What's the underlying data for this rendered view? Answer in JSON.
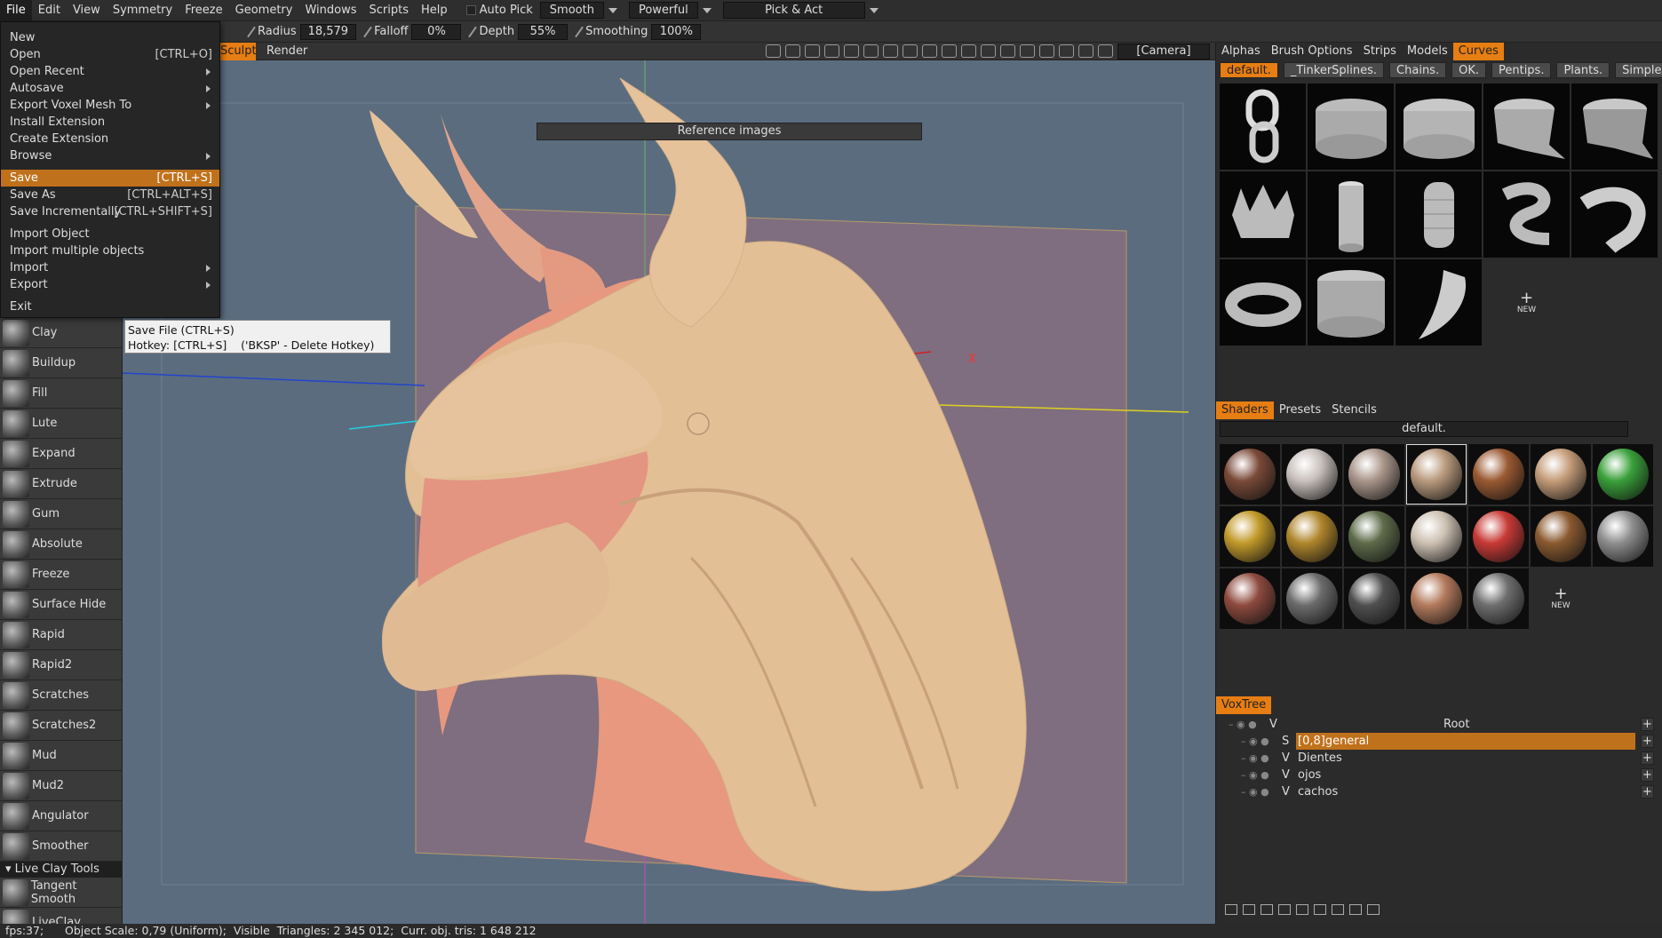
{
  "menubar": {
    "items": [
      "File",
      "Edit",
      "View",
      "Symmetry",
      "Freeze",
      "Geometry",
      "Windows",
      "Scripts",
      "Help"
    ],
    "auto_pick_label": "Auto Pick",
    "smooth_mode": "Smooth",
    "strength_mode": "Powerful",
    "pick_act_label": "Pick & Act"
  },
  "toolbar2": {
    "radius_label": "Radius",
    "radius_value": "18,579",
    "falloff_label": "Falloff",
    "falloff_value": "0%",
    "depth_label": "Depth",
    "depth_value": "55%",
    "smoothing_label": "Smoothing",
    "smoothing_value": "100%"
  },
  "rooms": {
    "sculpt": "Sculpt",
    "render": "Render",
    "camera": "[Camera]"
  },
  "viewport": {
    "reference_images": "Reference images",
    "axis_x_label": "X"
  },
  "file_menu": {
    "items": [
      {
        "label": "New",
        "hotkey": ""
      },
      {
        "label": "Open",
        "hotkey": "[CTRL+O]"
      },
      {
        "label": "Open Recent",
        "hotkey": ""
      },
      {
        "label": "Autosave",
        "hotkey": ""
      },
      {
        "label": "Export Voxel Mesh To",
        "hotkey": ""
      },
      {
        "label": "Install Extension",
        "hotkey": ""
      },
      {
        "label": "Create Extension",
        "hotkey": ""
      },
      {
        "label": "Browse",
        "hotkey": ""
      },
      {
        "label": "Save",
        "hotkey": "[CTRL+S]"
      },
      {
        "label": "Save As",
        "hotkey": "[CTRL+ALT+S]"
      },
      {
        "label": "Save Incrementally",
        "hotkey": "[CTRL+SHIFT+S]"
      },
      {
        "label": "Import Object",
        "hotkey": ""
      },
      {
        "label": "Import multiple objects",
        "hotkey": ""
      },
      {
        "label": "Import",
        "hotkey": ""
      },
      {
        "label": "Export",
        "hotkey": ""
      },
      {
        "label": "Exit",
        "hotkey": ""
      }
    ]
  },
  "tooltip": {
    "line1": "Save File (CTRL+S)",
    "line2": "Hotkey: [CTRL+S]    ('BKSP' - Delete Hotkey)"
  },
  "brushes": {
    "items": [
      "Clay",
      "Buildup",
      "Fill",
      "Lute",
      "Expand",
      "Extrude",
      "Gum",
      "Absolute",
      "Freeze",
      "Surface Hide",
      "Rapid",
      "Rapid2",
      "Scratches",
      "Scratches2",
      "Mud",
      "Mud2",
      "Angulator",
      "Smoother"
    ],
    "group_header": "Live Clay Tools",
    "after_group": [
      "Tangent Smooth",
      "LiveClay"
    ]
  },
  "right_panel": {
    "top_tabs": [
      "Alphas",
      "Brush Options",
      "Strips",
      "Models",
      "Curves"
    ],
    "presets": [
      "default.",
      "_TinkerSplines.",
      "Chains.",
      "OK.",
      "Pentips.",
      "Plants.",
      "Simple."
    ],
    "new_label": "NEW",
    "shader_tabs": [
      "Shaders",
      "Presets",
      "Stencils"
    ],
    "shader_preset": "default.",
    "shader_colors": [
      "#7a4a38",
      "#c8c0bc",
      "#a9958a",
      "#b99a7d",
      "#9a5a32",
      "#c49c78",
      "#3aa03a",
      "#c29a2a",
      "#b0862c",
      "#5d6b4a",
      "#cdc1b3",
      "#c83a36",
      "#8a5a30",
      "#8e8e8e",
      "#8e4a3e",
      "#6c6c6c",
      "#505050",
      "#b37a5c",
      "#6e6e6e"
    ]
  },
  "voxtree": {
    "title": "VoxTree",
    "rows": [
      {
        "type": "V",
        "name": "Root"
      },
      {
        "type": "S",
        "name": "[0,8]general"
      },
      {
        "type": "V",
        "name": "Dientes"
      },
      {
        "type": "V",
        "name": "ojos"
      },
      {
        "type": "V",
        "name": "cachos"
      }
    ]
  },
  "status": {
    "text": "fps:37;      Object Scale: 0,79 (Uniform);  Visible  Triangles: 2 345 012;  Curr. obj. tris: 1 648 212"
  }
}
